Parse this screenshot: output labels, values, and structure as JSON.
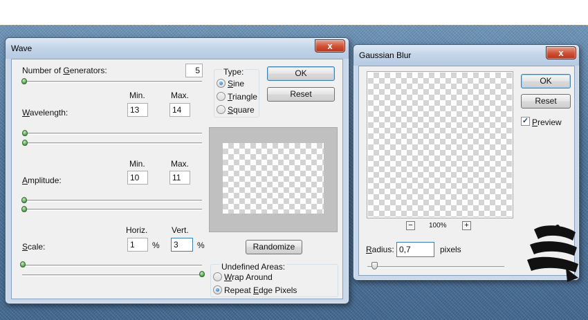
{
  "wave": {
    "title": "Wave",
    "close_glyph": "x",
    "generators": {
      "label_pre": "Number of ",
      "label_ul": "G",
      "label_post": "enerators:",
      "value": "5"
    },
    "col_min": "Min.",
    "col_max": "Max.",
    "wavelength": {
      "label_ul": "W",
      "label_post": "avelength:",
      "min": "13",
      "max": "14"
    },
    "amplitude": {
      "label_ul": "A",
      "label_post": "mplitude:",
      "min": "10",
      "max": "11"
    },
    "col_horiz": "Horiz.",
    "col_vert": "Vert.",
    "scale": {
      "label_ul": "S",
      "label_post": "cale:",
      "horiz": "1",
      "vert": "3",
      "unit": "%"
    },
    "type": {
      "label": "Type:",
      "sine": {
        "ul": "S",
        "rest": "ine",
        "selected": true
      },
      "triangle": {
        "ul": "T",
        "rest": "riangle",
        "selected": false
      },
      "square": {
        "ul": "S",
        "rest": "quare",
        "selected": false
      }
    },
    "ok_label": "OK",
    "reset_label": "Reset",
    "randomize_label": "Randomize",
    "undefined": {
      "label": "Undefined Areas:",
      "wrap": {
        "ul": "W",
        "rest": "rap Around",
        "selected": false
      },
      "repeat": {
        "pre": "Repeat ",
        "ul": "E",
        "rest": "dge Pixels",
        "selected": true
      }
    }
  },
  "gaussian": {
    "title": "Gaussian Blur",
    "close_glyph": "x",
    "ok_label": "OK",
    "reset_label": "Reset",
    "preview": {
      "ul": "P",
      "rest": "review",
      "checked": true,
      "check_glyph": "✓"
    },
    "zoom": {
      "minus": "−",
      "plus": "+",
      "level": "100%"
    },
    "radius": {
      "ul": "R",
      "rest": "adius:",
      "value": "0,7",
      "unit": "pixels"
    }
  },
  "colors": {
    "accent": "#3c7fb1",
    "close": "#c8452b",
    "denim": "#52789e"
  },
  "icons": {
    "logo": "brand-logo-icon"
  }
}
